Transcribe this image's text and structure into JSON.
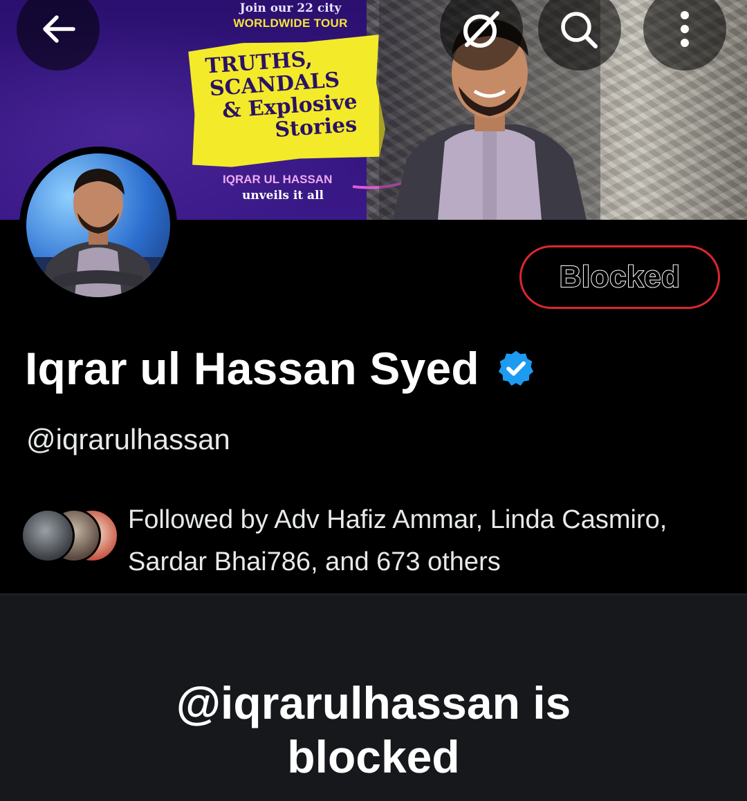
{
  "banner": {
    "tour_line1": "Join our 22 city",
    "tour_line2": "WORLDWIDE TOUR",
    "headline": [
      "TRUTHS,",
      "SCANDALS",
      "& Explosive",
      "Stories"
    ],
    "byline1": "IQRAR UL HASSAN",
    "byline2": "unveils it all"
  },
  "topbar": {
    "back_icon": "arrow-left-icon",
    "grok_icon": "grok-icon",
    "search_icon": "search-icon",
    "more_icon": "more-vertical-icon"
  },
  "profile": {
    "blocked_label": "Blocked",
    "name": "Iqrar ul Hassan Syed",
    "verified": true,
    "handle": "@iqrarulhassan",
    "followed_by": "Followed by Adv Hafiz Ammar, Linda Casmiro, Sardar Bhai786, and 673 others"
  },
  "blocked_notice": {
    "line1": "@iqrarulhassan is",
    "line2": "blocked"
  },
  "colors": {
    "accent_red": "#e0262f",
    "verified_blue": "#1d9bf0",
    "panel_bg": "#16181c",
    "banner_yellow": "#f3ea2a",
    "banner_purple": "#3a1988"
  }
}
